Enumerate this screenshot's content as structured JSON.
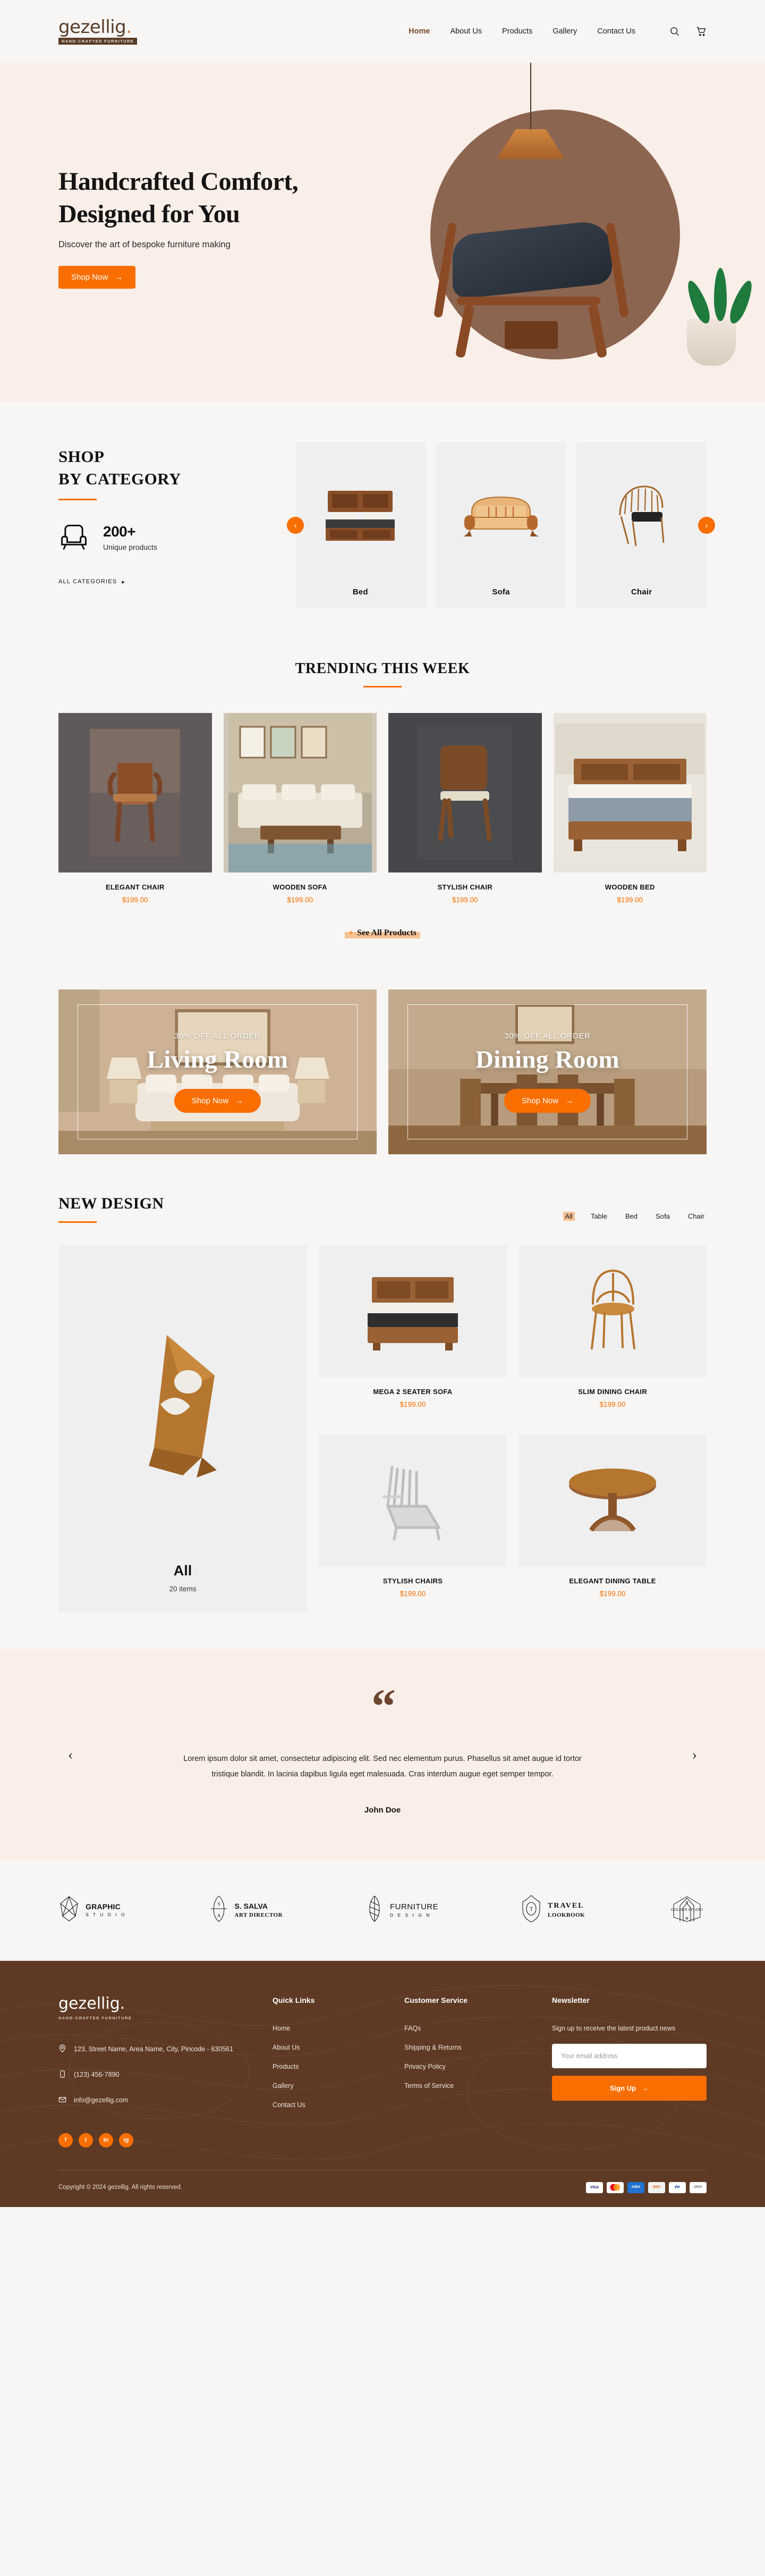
{
  "brand": {
    "name": "gezellig",
    "dot": ".",
    "tagline": "HAND-CRAFTED  FURNITURE",
    "accent": "#f96e00",
    "footer_bg": "#5e3a24"
  },
  "nav": {
    "items": [
      {
        "label": "Home",
        "active": true
      },
      {
        "label": "About Us",
        "active": false
      },
      {
        "label": "Products",
        "active": false
      },
      {
        "label": "Gallery",
        "active": false
      },
      {
        "label": "Contact Us",
        "active": false
      }
    ],
    "search_icon": "search-icon",
    "cart_icon": "cart-icon"
  },
  "hero": {
    "title_line1": "Handcrafted Comfort,",
    "title_line2": "Designed for You",
    "subtitle": "Discover the art of bespoke furniture making",
    "cta": "Shop Now"
  },
  "shop_category": {
    "title_line1": "SHOP",
    "title_line2": "BY CATEGORY",
    "stat_number": "200+",
    "stat_label": "Unique products",
    "all_link": "ALL CATEGORIES",
    "cards": [
      {
        "label": "Bed"
      },
      {
        "label": "Sofa"
      },
      {
        "label": "Chair"
      }
    ]
  },
  "trending": {
    "title": "TRENDING THIS WEEK",
    "products": [
      {
        "name": "ELEGANT CHAIR",
        "price": "$199.00"
      },
      {
        "name": "WOODEN SOFA",
        "price": "$199.00"
      },
      {
        "name": "STYLISH CHAIR",
        "price": "$199.00"
      },
      {
        "name": "WOODEN BED",
        "price": "$199.00"
      }
    ],
    "see_all_plus": "+",
    "see_all": "See All Products"
  },
  "banners": [
    {
      "sub": "30% OFF ALL ORDER",
      "title": "Living Room",
      "cta": "Shop Now"
    },
    {
      "sub": "30% OFF ALL ORDER",
      "title": "Dining Room",
      "cta": "Shop Now"
    }
  ],
  "new_design": {
    "title": "NEW DESIGN",
    "filters": [
      {
        "label": "All",
        "active": true
      },
      {
        "label": "Table",
        "active": false
      },
      {
        "label": "Bed",
        "active": false
      },
      {
        "label": "Sofa",
        "active": false
      },
      {
        "label": "Chair",
        "active": false
      }
    ],
    "feature": {
      "title": "All",
      "subtitle": "20 items"
    },
    "products": [
      {
        "name": "MEGA 2 SEATER SOFA",
        "price": "$199.00"
      },
      {
        "name": "SLIM DINING CHAIR",
        "price": "$199.00"
      },
      {
        "name": "STYLISH CHAIRS",
        "price": "$199.00"
      },
      {
        "name": "ELEGANT DINING TABLE",
        "price": "$199.00"
      }
    ]
  },
  "testimonial": {
    "quote_glyph": "“",
    "text": "Lorem ipsum dolor sit amet, consectetur adipiscing elit. Sed nec elementum purus. Phasellus sit amet augue id tortor tristique blandit. In lacinia dapibus ligula eget malesuada. Cras interdum augue eget semper tempor.",
    "author": "John Doe",
    "prev": "‹",
    "next": "›"
  },
  "brands": [
    {
      "line1": "GRAPHIC",
      "line2": "S T U D I O",
      "style": "sans"
    },
    {
      "line1": "S. SALVA",
      "line2": "ART DIRECTOR",
      "style": "mixed"
    },
    {
      "line1": "FURNITURE",
      "line2": "D E S I G N",
      "style": "sans"
    },
    {
      "line1": "TRAVEL",
      "line2": "LOOKBOOK",
      "style": "serif"
    },
    {
      "line1": "GOLDEN STUDIO",
      "line2": "",
      "style": "badge"
    }
  ],
  "footer": {
    "address": "123,  Street Name, Area Name, City, Pincode - 630561",
    "phone": "(123) 456-7890",
    "email": "info@gezellig.com",
    "quick_links_title": "Quick Links",
    "quick_links": [
      "Home",
      "About Us",
      "Products",
      "Gallery",
      "Contact Us"
    ],
    "customer_service_title": "Customer Service",
    "customer_service": [
      "FAQs",
      "Shipping & Returns",
      "Privacy Policy",
      "Terms of Service"
    ],
    "newsletter_title": "Newsletter",
    "newsletter_text": "Sign up to receive the latest product news",
    "email_placeholder": "Your email address",
    "signup_label": "Sign Up",
    "socials": [
      "f",
      "t",
      "in",
      "ig"
    ],
    "copyright": "Copyright © 2024 gezellig. All rights reserved.",
    "payments": [
      "VISA",
      "MC",
      "AMEX",
      "DISC",
      "PP",
      "GPAY"
    ]
  }
}
